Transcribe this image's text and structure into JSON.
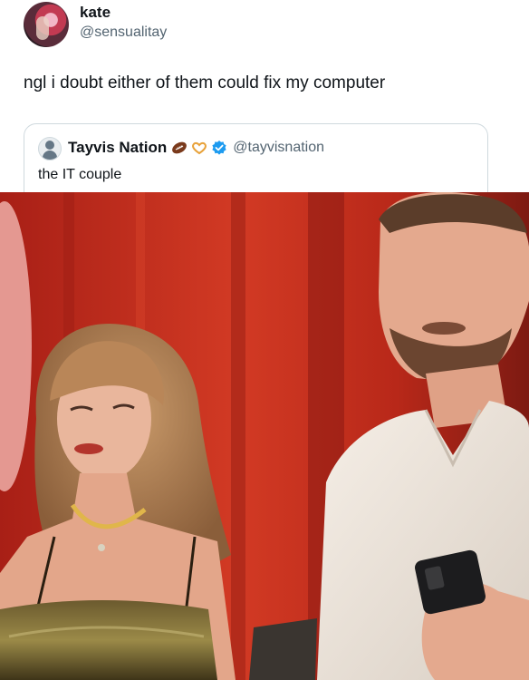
{
  "tweet": {
    "display_name": "kate",
    "handle": "@sensualitay",
    "text": "ngl i doubt either of them could fix my computer"
  },
  "quote": {
    "display_name": "Tayvis Nation",
    "badges": [
      "football-emoji",
      "heart-hands-emoji",
      "verified-badge-icon"
    ],
    "handle": "@tayvisnation",
    "text": "the IT couple"
  },
  "colors": {
    "accent_blue": "#1d9bf0",
    "secondary_text": "#536471",
    "background_red": "#b8281d"
  }
}
